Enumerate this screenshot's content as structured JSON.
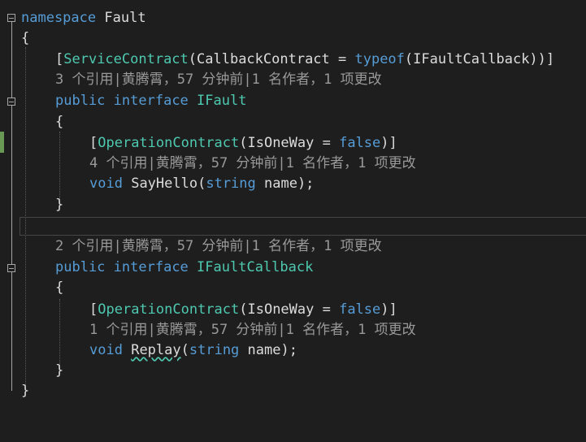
{
  "lines": [
    {
      "t": "namespace",
      "n": "Fault"
    },
    {
      "t": "{"
    },
    {
      "attr_open": "[",
      "attr_name": "ServiceContract",
      "attr_paren": "(CallbackContract = ",
      "kw": "typeof",
      "arg": "(IFaultCallback))]"
    },
    {
      "lens": "3 个引用|黄腾霄，57 分钟前|1 名作者，1 项更改"
    },
    {
      "kw1": "public",
      "kw2": "interface",
      "name": "IFault"
    },
    {
      "t": "{"
    },
    {
      "attr_open": "[",
      "attr_name": "OperationContract",
      "attr_paren": "(IsOneWay = ",
      "kw": "false",
      "arg": ")]"
    },
    {
      "lens": "4 个引用|黄腾霄，57 分钟前|1 名作者，1 项更改"
    },
    {
      "kw1": "void",
      "method": "SayHello",
      "p1": "(",
      "kw2": "string",
      "p2": " name);"
    },
    {
      "t": "}"
    },
    {
      "t": ""
    },
    {
      "lens": "2 个引用|黄腾霄，57 分钟前|1 名作者，1 项更改"
    },
    {
      "kw1": "public",
      "kw2": "interface",
      "name": "IFaultCallback"
    },
    {
      "t": "{"
    },
    {
      "attr_open": "[",
      "attr_name": "OperationContract",
      "attr_paren": "(IsOneWay = ",
      "kw": "false",
      "arg": ")]"
    },
    {
      "lens": "1 个引用|黄腾霄，57 分钟前|1 名作者，1 项更改"
    },
    {
      "kw1": "void",
      "method": "Replay",
      "p1": "(",
      "kw2": "string",
      "p2": " name);"
    },
    {
      "t": "}"
    },
    {
      "t": "}"
    }
  ]
}
